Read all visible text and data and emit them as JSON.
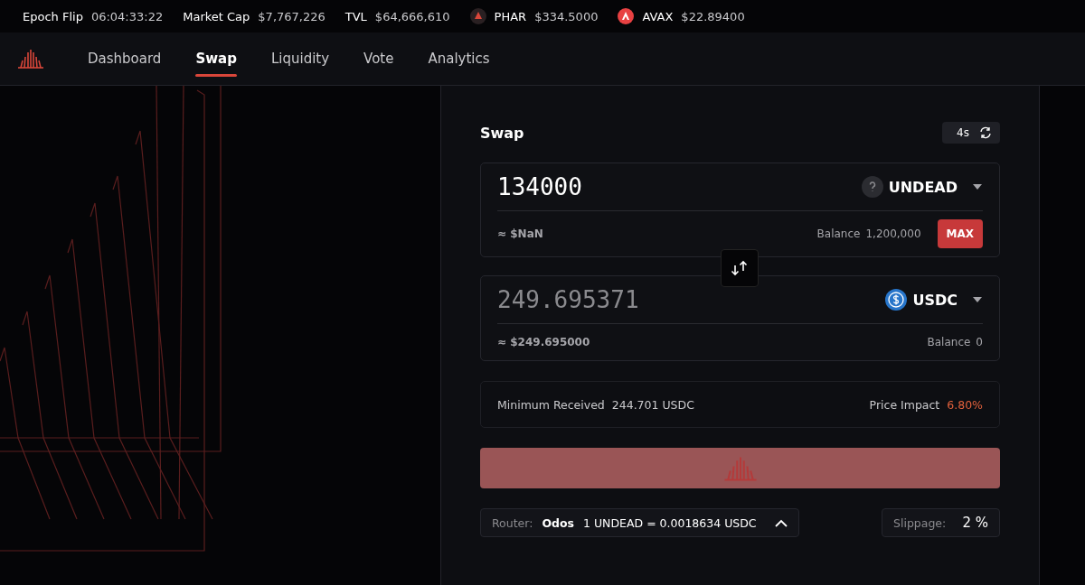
{
  "ticker": [
    {
      "kind": "stat",
      "label": "Epoch Flip",
      "value": "06:04:33:22"
    },
    {
      "kind": "stat",
      "label": "Market Cap",
      "value": "$7,767,226"
    },
    {
      "kind": "stat",
      "label": "TVL",
      "value": "$64,666,610"
    },
    {
      "kind": "phar",
      "label": "PHAR",
      "value": "$334.5000"
    },
    {
      "kind": "avax",
      "label": "AVAX",
      "value": "$22.89400"
    }
  ],
  "nav": {
    "tabs": [
      {
        "label": "Dashboard",
        "selected": false
      },
      {
        "label": "Swap",
        "selected": true
      },
      {
        "label": "Liquidity",
        "selected": false
      },
      {
        "label": "Vote",
        "selected": false
      },
      {
        "label": "Analytics",
        "selected": false
      }
    ]
  },
  "swap": {
    "title": "Swap",
    "refresh": "4s",
    "from": {
      "amount": "134000",
      "readonly": false,
      "token": {
        "label": "UNDEAD",
        "kind": "unknown"
      },
      "usd": "≈ $NaN",
      "balance_label": "Balance",
      "balance": "1,200,000",
      "max": "MAX"
    },
    "to": {
      "amount": "249.695371",
      "readonly": true,
      "token": {
        "label": "USDC",
        "kind": "usdc"
      },
      "usd": "≈ $249.695000",
      "balance_label": "Balance",
      "balance": "0"
    },
    "info": {
      "min_label": "Minimum Received",
      "min_value": "244.701 USDC",
      "impact_label": "Price Impact",
      "impact_value": "6.80%"
    },
    "action": {
      "disabled": true
    },
    "router": {
      "label": "Router:",
      "name": "Odos",
      "rate": "1 UNDEAD = 0.0018634 USDC"
    },
    "slippage": {
      "label": "Slippage:",
      "value": "2 %"
    }
  }
}
